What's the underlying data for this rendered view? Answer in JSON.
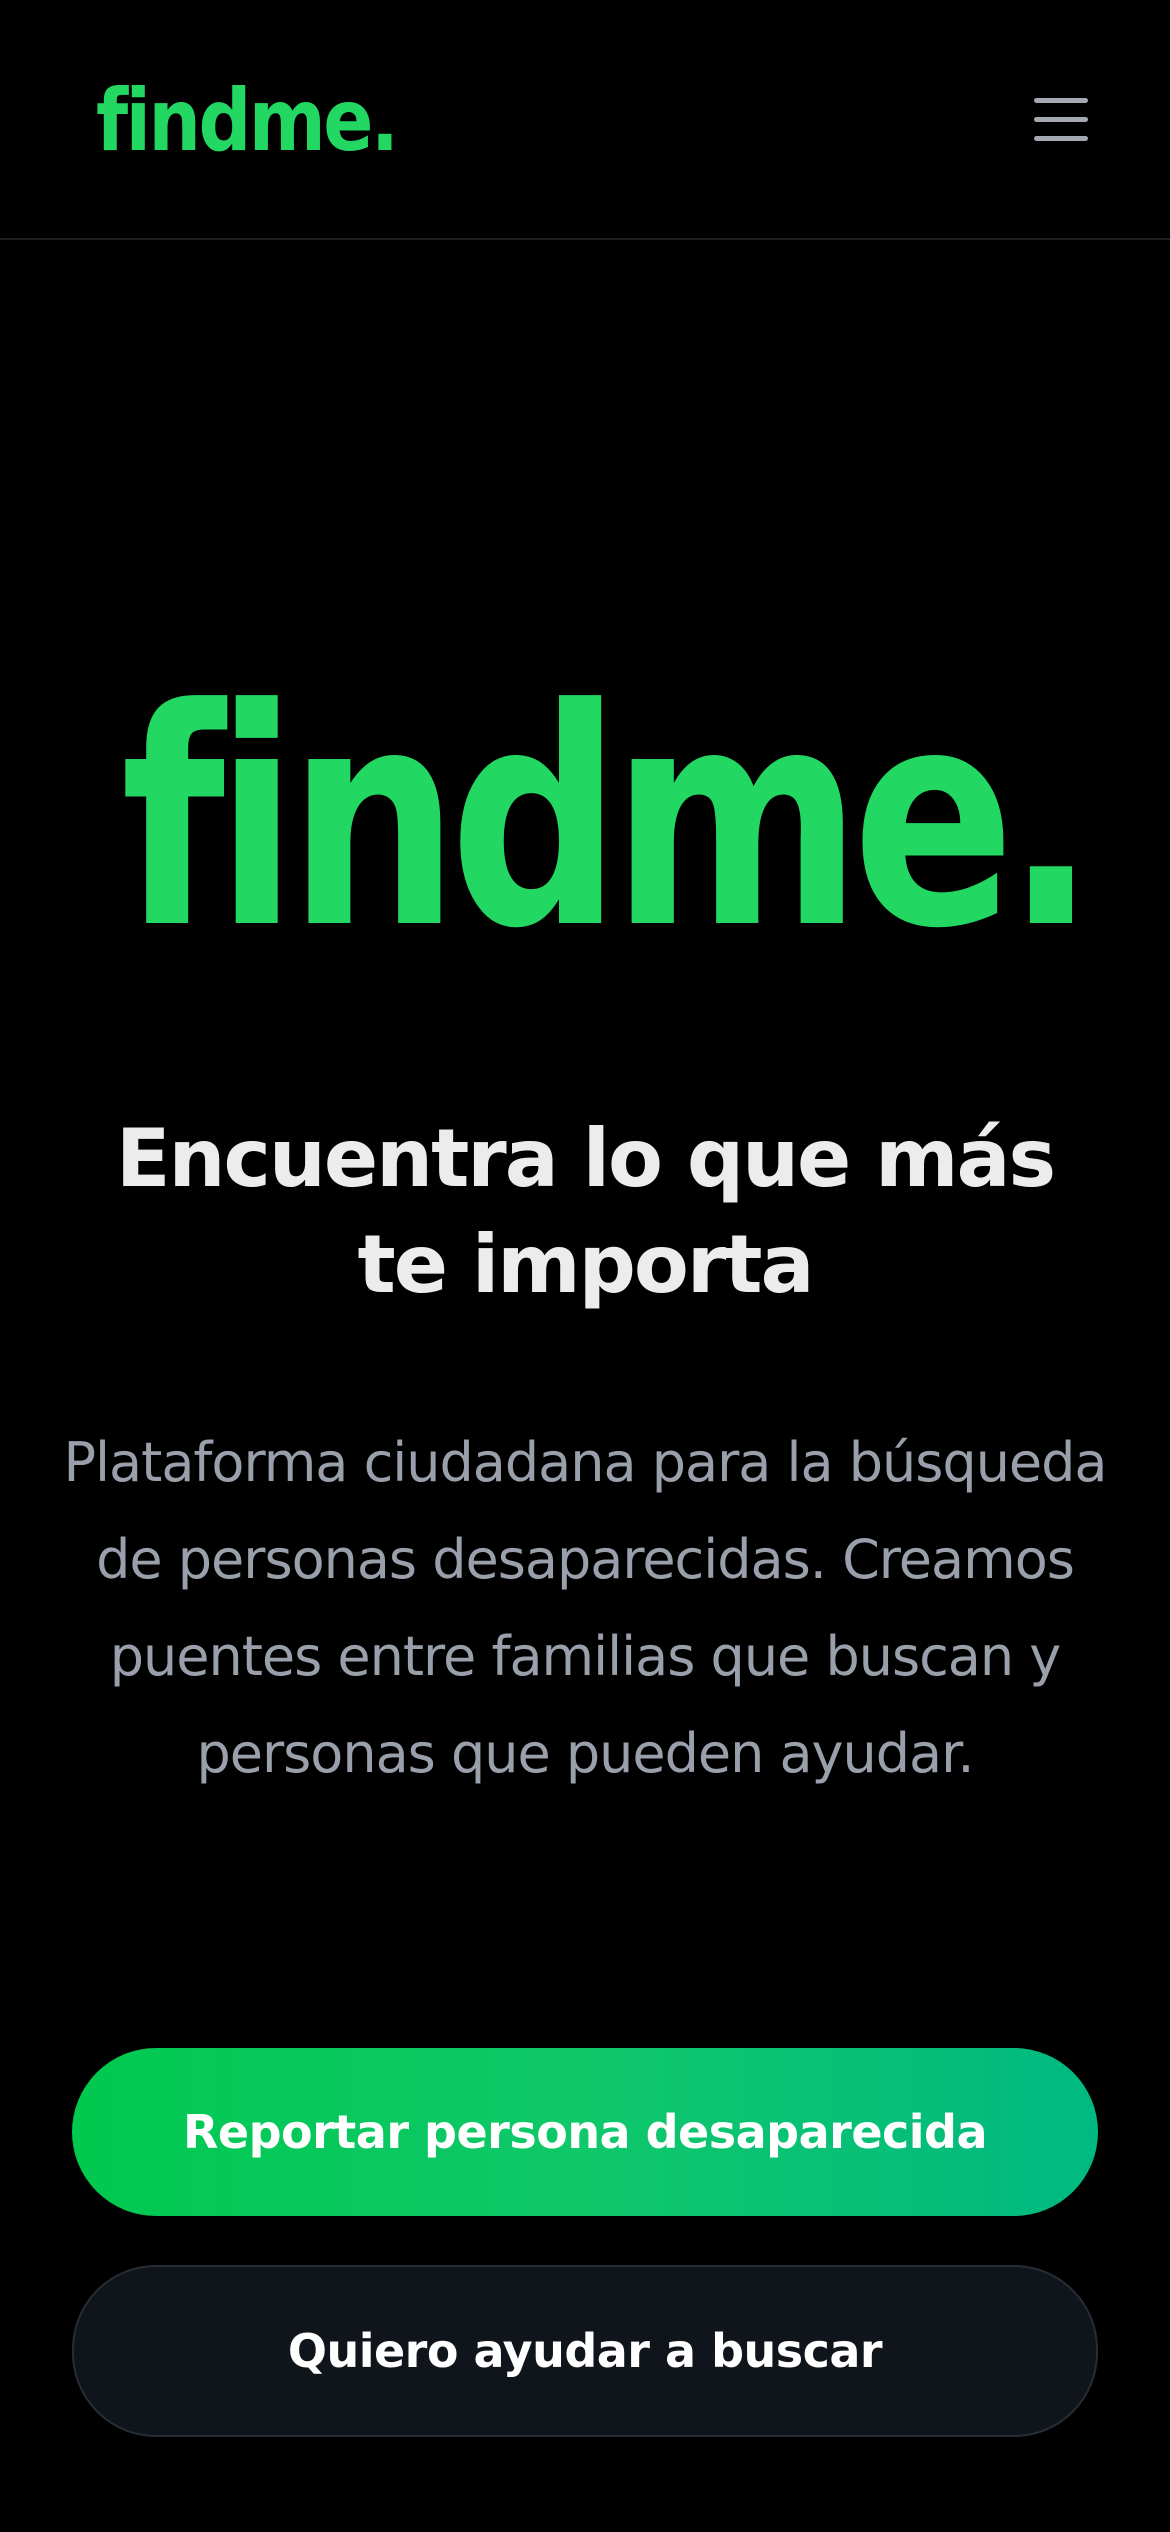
{
  "header": {
    "brand": "findme.",
    "menu_icon": "hamburger-menu-icon"
  },
  "hero": {
    "logo": "findme.",
    "headline": "Encuentra lo que más te importa",
    "subtitle": "Plataforma ciudadana para la búsqueda de personas desaparecidas. Creamos puentes entre familias que buscan y personas que pueden ayudar."
  },
  "actions": {
    "primary_label": "Reportar persona desaparecida",
    "secondary_label": "Quiero ayudar a buscar"
  },
  "colors": {
    "brand_green": "#22d862",
    "background": "#000000",
    "headline": "#ececec",
    "subtitle": "#9aa0ab",
    "primary_gradient_start": "#00c94e",
    "primary_gradient_end": "#00b981",
    "secondary_bg": "#10151c"
  }
}
